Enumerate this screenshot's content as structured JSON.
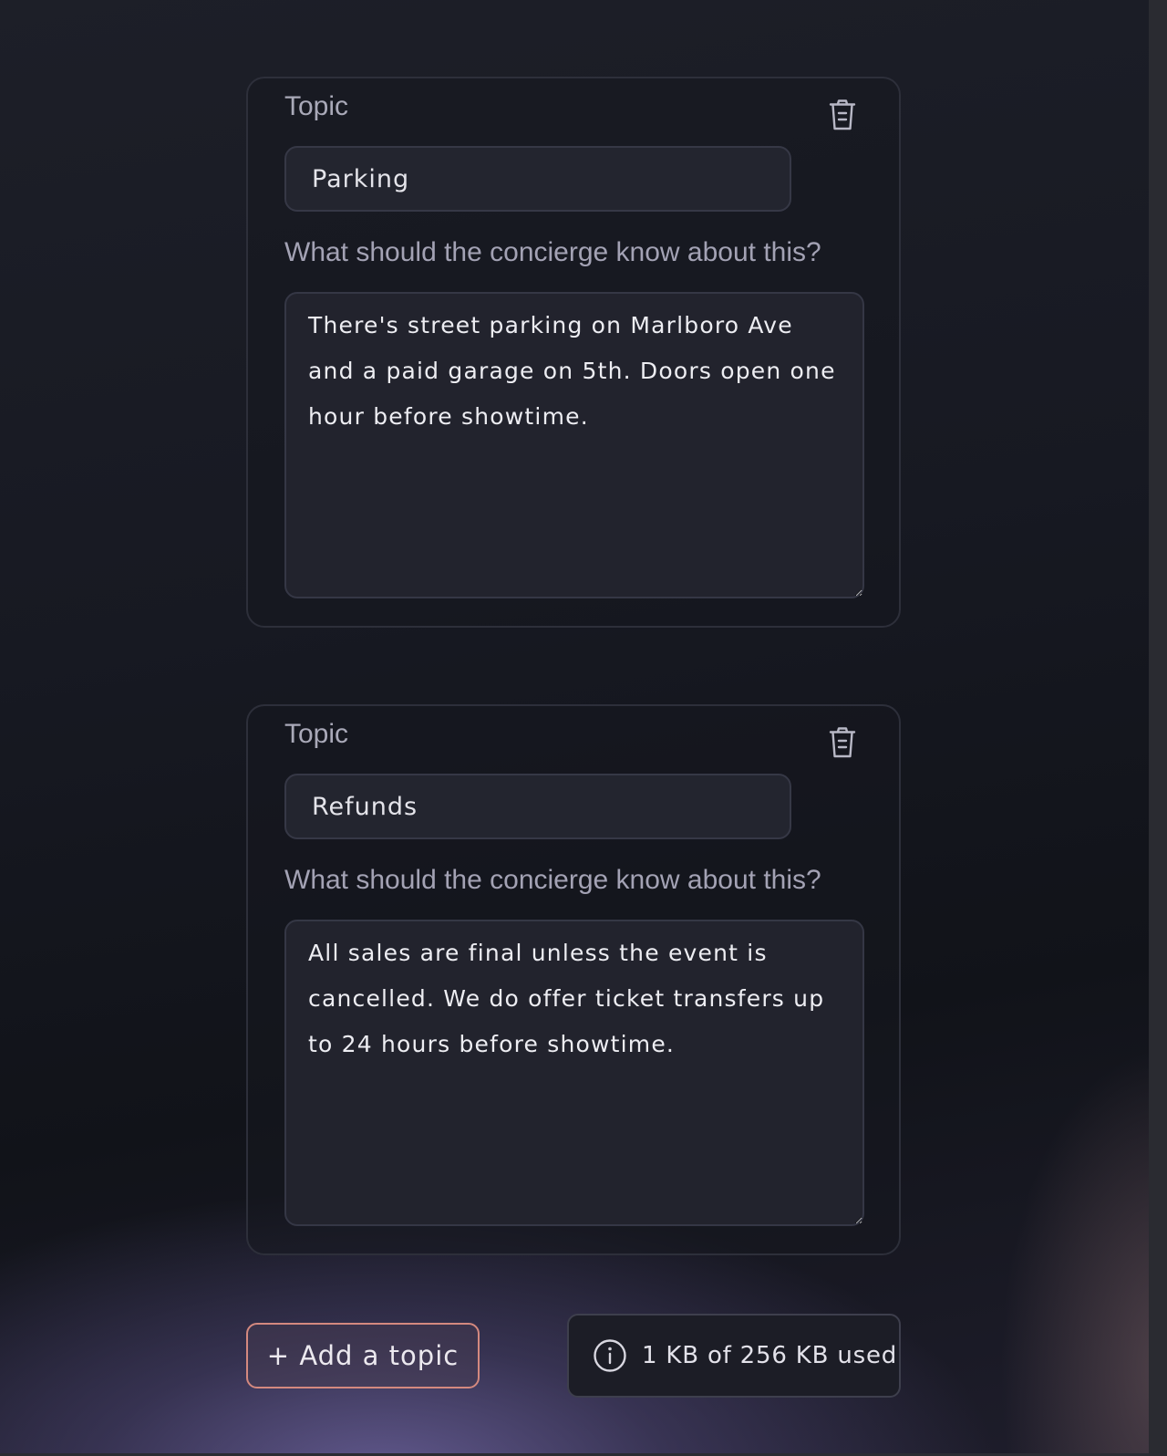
{
  "topics": [
    {
      "topic_label": "Topic",
      "topic_value": "Parking",
      "question_label": "What should the concierge know about this?",
      "answer": "There's street parking on Marlboro Ave and a paid garage on 5th. Doors open one hour before showtime."
    },
    {
      "topic_label": "Topic",
      "topic_value": "Refunds",
      "question_label": "What should the concierge know about this?",
      "answer": "All sales are final unless the event is cancelled. We do offer ticket transfers up to 24 hours before showtime."
    }
  ],
  "add_button": {
    "label": "+ Add a topic"
  },
  "storage": {
    "text": "1 KB of 256 KB used",
    "used_kb": 1,
    "total_kb": 256,
    "icon": "info-icon"
  },
  "colors": {
    "accent_border": "#d4897f",
    "card_border": "#2d2f3a",
    "label_text": "#a9a9b8"
  },
  "icons": {
    "delete": "trash-icon"
  }
}
